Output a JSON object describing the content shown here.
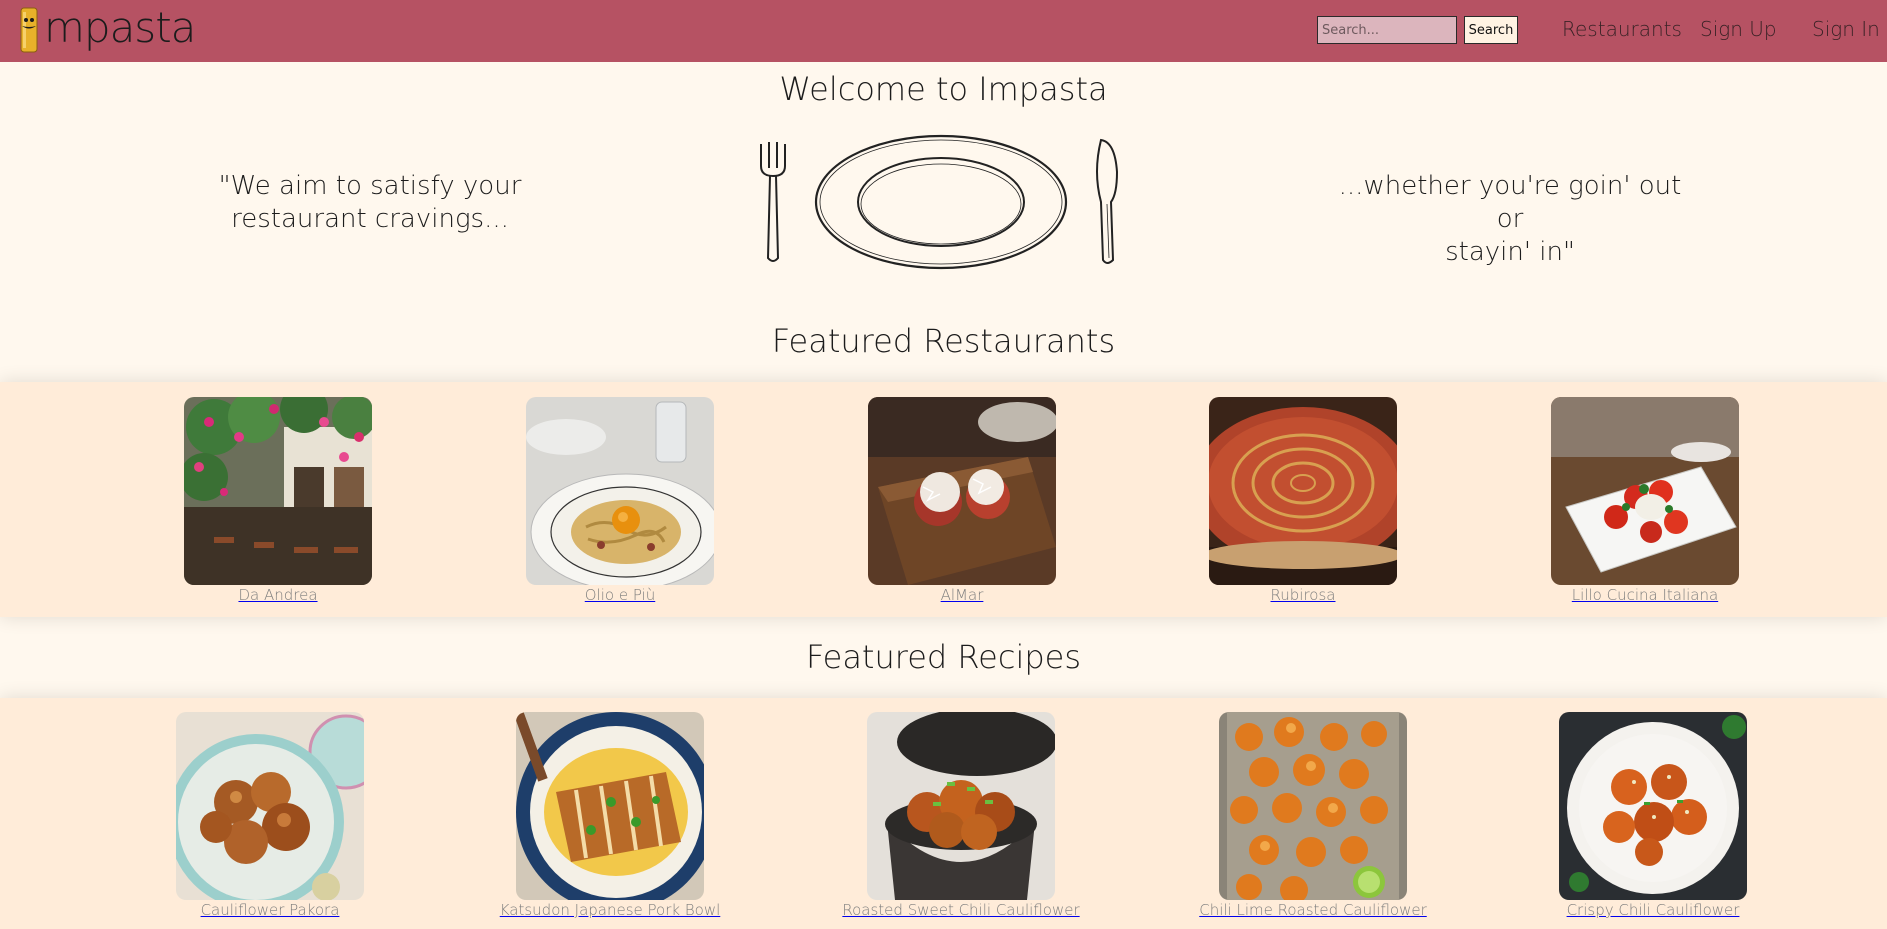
{
  "header": {
    "logo_text": "mpasta",
    "search_placeholder": "Search...",
    "search_button": "Search",
    "nav": [
      "Restaurants",
      "Sign Up",
      "Sign In"
    ]
  },
  "hero": {
    "title": "Welcome to Impasta",
    "quote_left_line1": "\"We aim to satisfy your",
    "quote_left_line2": "restaurant cravings...",
    "quote_right_line1": "...whether you're goin' out or",
    "quote_right_line2": "stayin' in\""
  },
  "featured_restaurants": {
    "title": "Featured Restaurants",
    "items": [
      "Da Andrea",
      "Olio e Più",
      "AlMar",
      "Rubirosa",
      "Lillo Cucina Italiana"
    ]
  },
  "featured_recipes": {
    "title": "Featured Recipes",
    "items": [
      "Cauliflower Pakora",
      "Katsudon Japanese Pork Bowl",
      "Roasted Sweet Chili Cauliflower",
      "Chili Lime Roasted Cauliflower",
      "Crispy Chili Cauliflower"
    ]
  },
  "colors": {
    "nav_bg": "#b65263",
    "page_bg": "#fff8ee",
    "band_bg": "#ffecd9"
  }
}
